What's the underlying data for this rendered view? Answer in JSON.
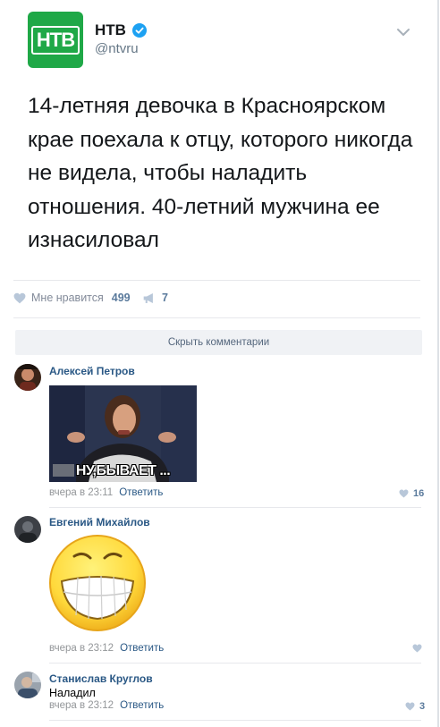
{
  "tweet": {
    "logo_text": "НТВ",
    "account_name": "НТВ",
    "account_handle": "@ntvru",
    "text": "14-летняя девочка в Красноярском крае поехала к отцу, которого никогда не видела, чтобы наладить отношения. 40-летний мужчина ее изнасиловал"
  },
  "post": {
    "like_label": "Мне нравится",
    "like_count": "499",
    "share_count": "7",
    "hide_comments_label": "Скрыть комментарии"
  },
  "comments": [
    {
      "author": "Алексей Петров",
      "sticker_caption": "НУ,БЫВАЕТ ...",
      "time": "вчера в 23:11",
      "reply_label": "Ответить",
      "likes": "16"
    },
    {
      "author": "Евгений Михайлов",
      "time": "вчера в 23:12",
      "reply_label": "Ответить",
      "likes": ""
    },
    {
      "author": "Станислав Круглов",
      "text": "Наладил",
      "time": "вчера в 23:12",
      "reply_label": "Ответить",
      "likes": "3"
    }
  ],
  "colors": {
    "logo_green": "#1fa847",
    "link_blue": "#2a5885",
    "verified_blue": "#1da1f2",
    "smiley_yellow": "#ffd93b"
  },
  "icons": [
    "verified-icon",
    "chevron-down-icon",
    "heart-icon",
    "megaphone-icon"
  ]
}
